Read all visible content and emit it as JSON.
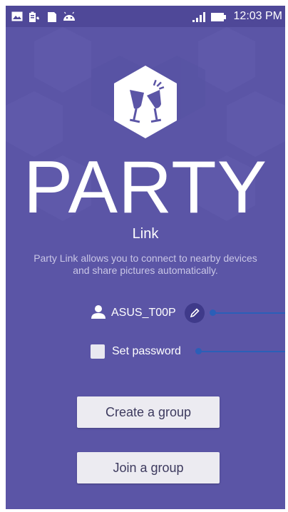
{
  "status_bar": {
    "time": "12:03 PM",
    "left_icons": [
      "image-icon",
      "battery-saver-icon",
      "sd-card-icon",
      "android-icon"
    ],
    "right_icons": [
      "signal-icon",
      "battery-icon"
    ]
  },
  "app": {
    "logo_icon": "cheers-glasses-icon",
    "title": "PARTY",
    "subtitle": "Link",
    "description": "Party Link allows you to connect to nearby devices and share pictures automatically."
  },
  "device": {
    "icon": "person-icon",
    "name": "ASUS_T00P",
    "edit_icon": "pencil-icon"
  },
  "password": {
    "label": "Set password",
    "checked": false
  },
  "buttons": {
    "create": "Create a group",
    "join": "Join a group"
  },
  "colors": {
    "background": "#5b55a6",
    "status_bar": "#4f4898",
    "accent_callout": "#2b5fb8",
    "button": "#ecebf1"
  }
}
